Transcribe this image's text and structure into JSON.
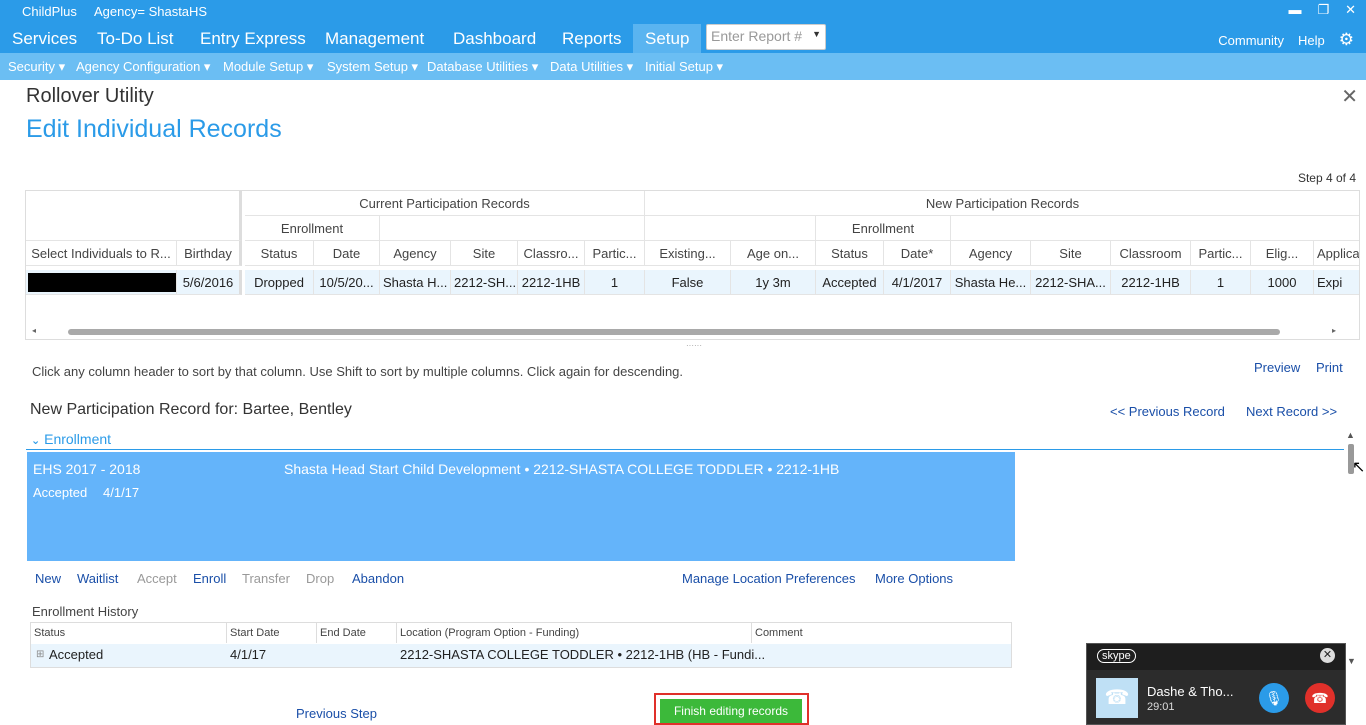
{
  "titlebar": {
    "app": "ChildPlus",
    "agency": "Agency= ShastaHS"
  },
  "winctl": {
    "minimize": "▬",
    "restore": "❐",
    "close": "✕"
  },
  "mainnav": {
    "items": [
      "Services",
      "To-Do List",
      "Entry Express",
      "Management",
      "Dashboard",
      "Reports",
      "Setup"
    ],
    "active": "Setup",
    "report_placeholder": "Enter Report #",
    "community": "Community",
    "help": "Help"
  },
  "subnav": {
    "items": [
      "Security ▾",
      "Agency Configuration ▾",
      "Module Setup ▾",
      "System Setup ▾",
      "Database Utilities ▾",
      "Data Utilities ▾",
      "Initial Setup ▾"
    ]
  },
  "page": {
    "title": "Rollover Utility",
    "subtitle": "Edit Individual Records",
    "step": "Step 4 of 4"
  },
  "grid": {
    "group_current": "Current Participation Records",
    "group_new": "New Participation Records",
    "enrollment": "Enrollment",
    "headers": [
      "Select Individuals to R...",
      "Birthday",
      "Status",
      "Date",
      "Agency",
      "Site",
      "Classro...",
      "Partic...",
      "Existing...",
      "Age on...",
      "Status",
      "Date*",
      "Agency",
      "Site",
      "Classroom",
      "Partic...",
      "Elig...",
      "Applica"
    ],
    "row": [
      "",
      "5/6/2016",
      "Dropped",
      "10/5/20...",
      "Shasta H...",
      "2212-SH...",
      "2212-1HB",
      "1",
      "False",
      "1y 3m",
      "Accepted",
      "4/1/2017",
      "Shasta He...",
      "2212-SHA...",
      "2212-1HB",
      "1",
      "1000",
      "Expi"
    ]
  },
  "sort_hint": "Click any column header to sort by that column. Use Shift to sort by multiple columns. Click again for descending.",
  "links": {
    "preview": "Preview",
    "print": "Print",
    "prev_record": "<< Previous Record",
    "next_record": "Next Record >>"
  },
  "record_for": "New Participation Record for:  Bartee, Bentley",
  "enrollment_section": "Enrollment",
  "card": {
    "program": "EHS 2017 - 2018",
    "location": "Shasta Head Start Child Development • 2212-SHASTA COLLEGE TODDLER • 2212-1HB",
    "status": "Accepted",
    "date": "4/1/17"
  },
  "actions": {
    "new": "New",
    "waitlist": "Waitlist",
    "accept": "Accept",
    "enroll": "Enroll",
    "transfer": "Transfer",
    "drop": "Drop",
    "abandon": "Abandon",
    "manage": "Manage Location Preferences",
    "more": "More Options"
  },
  "history": {
    "label": "Enrollment History",
    "headers": [
      "Status",
      "Start Date",
      "End Date",
      "Location (Program Option - Funding)",
      "Comment"
    ],
    "row": [
      "Accepted",
      "4/1/17",
      "",
      "2212-SHASTA COLLEGE TODDLER • 2212-1HB (HB - Fundi...",
      ""
    ]
  },
  "footer": {
    "previous_step": "Previous Step",
    "finish": "Finish editing records"
  },
  "skype": {
    "logo": "skype",
    "name": "Dashe & Tho...",
    "time": "29:01"
  },
  "colors": {
    "brand": "#2b9be8",
    "subnav": "#6bbef3",
    "card": "#64b4fa",
    "finish": "#3cb93a",
    "highlight": "#e0302a"
  }
}
